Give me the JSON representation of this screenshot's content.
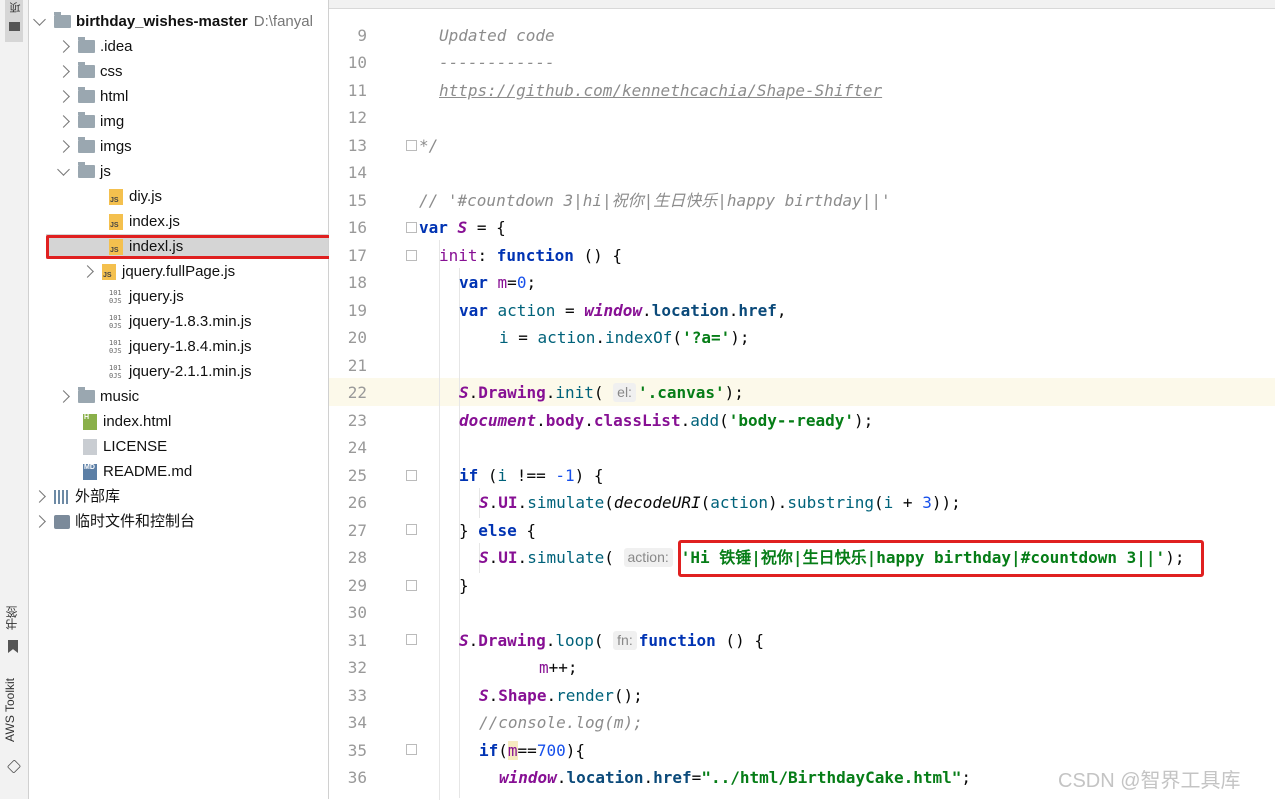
{
  "side_strip": {
    "top_label": "项",
    "bookmarks_label": "书签",
    "aws_label": "AWS Toolkit"
  },
  "project_tree": {
    "root": {
      "name": "birthday_wishes-master",
      "path": "D:\\fanyal"
    },
    "items": [
      {
        "label": ".idea",
        "icon": "folder-icon"
      },
      {
        "label": "css",
        "icon": "folder-icon"
      },
      {
        "label": "html",
        "icon": "folder-icon"
      },
      {
        "label": "img",
        "icon": "folder-icon"
      },
      {
        "label": "imgs",
        "icon": "folder-icon"
      },
      {
        "label": "js",
        "icon": "folder-icon"
      },
      {
        "label": "diy.js",
        "icon": "js-file-icon"
      },
      {
        "label": "index.js",
        "icon": "js-file-icon"
      },
      {
        "label": "indexl.js",
        "icon": "js-file-icon"
      },
      {
        "label": "jquery.fullPage.js",
        "icon": "js-file-icon"
      },
      {
        "label": "jquery.js",
        "icon": "binary-js-icon"
      },
      {
        "label": "jquery-1.8.3.min.js",
        "icon": "binary-js-icon"
      },
      {
        "label": "jquery-1.8.4.min.js",
        "icon": "binary-js-icon"
      },
      {
        "label": "jquery-2.1.1.min.js",
        "icon": "binary-js-icon"
      },
      {
        "label": "music",
        "icon": "folder-icon"
      },
      {
        "label": "index.html",
        "icon": "html-file-icon"
      },
      {
        "label": "LICENSE",
        "icon": "text-file-icon"
      },
      {
        "label": "README.md",
        "icon": "markdown-file-icon"
      },
      {
        "label": "外部库",
        "icon": "library-icon"
      },
      {
        "label": "临时文件和控制台",
        "icon": "scratch-icon"
      }
    ],
    "selected": "indexl.js"
  },
  "editor": {
    "line_numbers": [
      "9",
      "10",
      "11",
      "12",
      "13",
      "14",
      "15",
      "16",
      "17",
      "18",
      "19",
      "20",
      "21",
      "22",
      "23",
      "24",
      "25",
      "26",
      "27",
      "28",
      "29",
      "30",
      "31",
      "32",
      "33",
      "34",
      "35",
      "36"
    ],
    "l9": "Updated code",
    "l10": "------------",
    "l11": "https://github.com/kennethcachia/Shape-Shifter",
    "l13": "*/",
    "l15": "// '#countdown 3|hi|祝你|生日快乐|happy birthday||'",
    "l16_kw": "var",
    "l16_name": "S",
    "l16_rest": " = {",
    "l17_prop": "init",
    "l17_colon": ": ",
    "l17_kw": "function",
    "l17_rest": " () {",
    "l18_kw": "var",
    "l18_var": " m",
    "l18_eq": "=",
    "l18_num": "0",
    "l18_end": ";",
    "l19_kw": "var",
    "l19_var": " action",
    "l19_eq": " = ",
    "l19_win": "window",
    "l19_dot1": ".",
    "l19_loc": "location",
    "l19_dot2": ".",
    "l19_href": "href",
    "l19_end": ",",
    "l20_var": "i",
    "l20_eq": " = ",
    "l20_obj": "action",
    "l20_dot": ".",
    "l20_fn": "indexOf",
    "l20_open": "(",
    "l20_str": "'?a='",
    "l20_end": ");",
    "l22_s": "S",
    "l22_dot": ".",
    "l22_drawing": "Drawing",
    "l22_dot2": ".",
    "l22_fn": "init",
    "l22_open": "( ",
    "l22_hint": "el:",
    "l22_str": "'.canvas'",
    "l22_end": ");",
    "l23_doc": "document",
    "l23_dot": ".",
    "l23_body": "body",
    "l23_dot2": ".",
    "l23_cl": "classList",
    "l23_dot3": ".",
    "l23_fn": "add",
    "l23_open": "(",
    "l23_str": "'body--ready'",
    "l23_end": ");",
    "l25_kw": "if",
    "l25_open": " (",
    "l25_var": "i",
    "l25_op": " !== ",
    "l25_num": "-1",
    "l25_end": ") {",
    "l26_s": "S",
    "l26_dot": ".",
    "l26_ui": "UI",
    "l26_dot2": ".",
    "l26_fn": "simulate",
    "l26_open": "(",
    "l26_dec": "decodeURI",
    "l26_open2": "(",
    "l26_obj": "action",
    "l26_close": ")",
    "l26_dot3": ".",
    "l26_sub": "substring",
    "l26_open3": "(",
    "l26_var": "i",
    "l26_plus": " + ",
    "l26_num": "3",
    "l26_end": "));",
    "l27_a": "} ",
    "l27_kw": "else",
    "l27_b": " {",
    "l28_s": "S",
    "l28_dot": ".",
    "l28_ui": "UI",
    "l28_dot2": ".",
    "l28_fn": "simulate",
    "l28_open": "( ",
    "l28_hint": "action:",
    "l28_str": "'Hi 铁锤|祝你|生日快乐|happy birthday|#countdown 3||'",
    "l28_end": ");",
    "l29": "}",
    "l31_s": "S",
    "l31_dot": ".",
    "l31_drawing": "Drawing",
    "l31_dot2": ".",
    "l31_fn": "loop",
    "l31_open": "( ",
    "l31_hint": "fn:",
    "l31_kw": "function",
    "l31_rest": " () {",
    "l32_var": "m",
    "l32_end": "++;",
    "l33_s": "S",
    "l33_dot": ".",
    "l33_shape": "Shape",
    "l33_dot2": ".",
    "l33_fn": "render",
    "l33_end": "();",
    "l34": "//console.log(m);",
    "l35_kw": "if",
    "l35_open": "(",
    "l35_var": "m",
    "l35_op": "==",
    "l35_num": "700",
    "l35_end": "){",
    "l36_win": "window",
    "l36_dot": ".",
    "l36_loc": "location",
    "l36_dot2": ".",
    "l36_href": "href",
    "l36_eq": "=",
    "l36_str": "\"../html/BirthdayCake.html\"",
    "l36_end": ";"
  },
  "watermark": "CSDN @智界工具库",
  "colors": {
    "annotation_red": "#e02020",
    "keyword": "#0033b3",
    "string": "#067d17"
  }
}
